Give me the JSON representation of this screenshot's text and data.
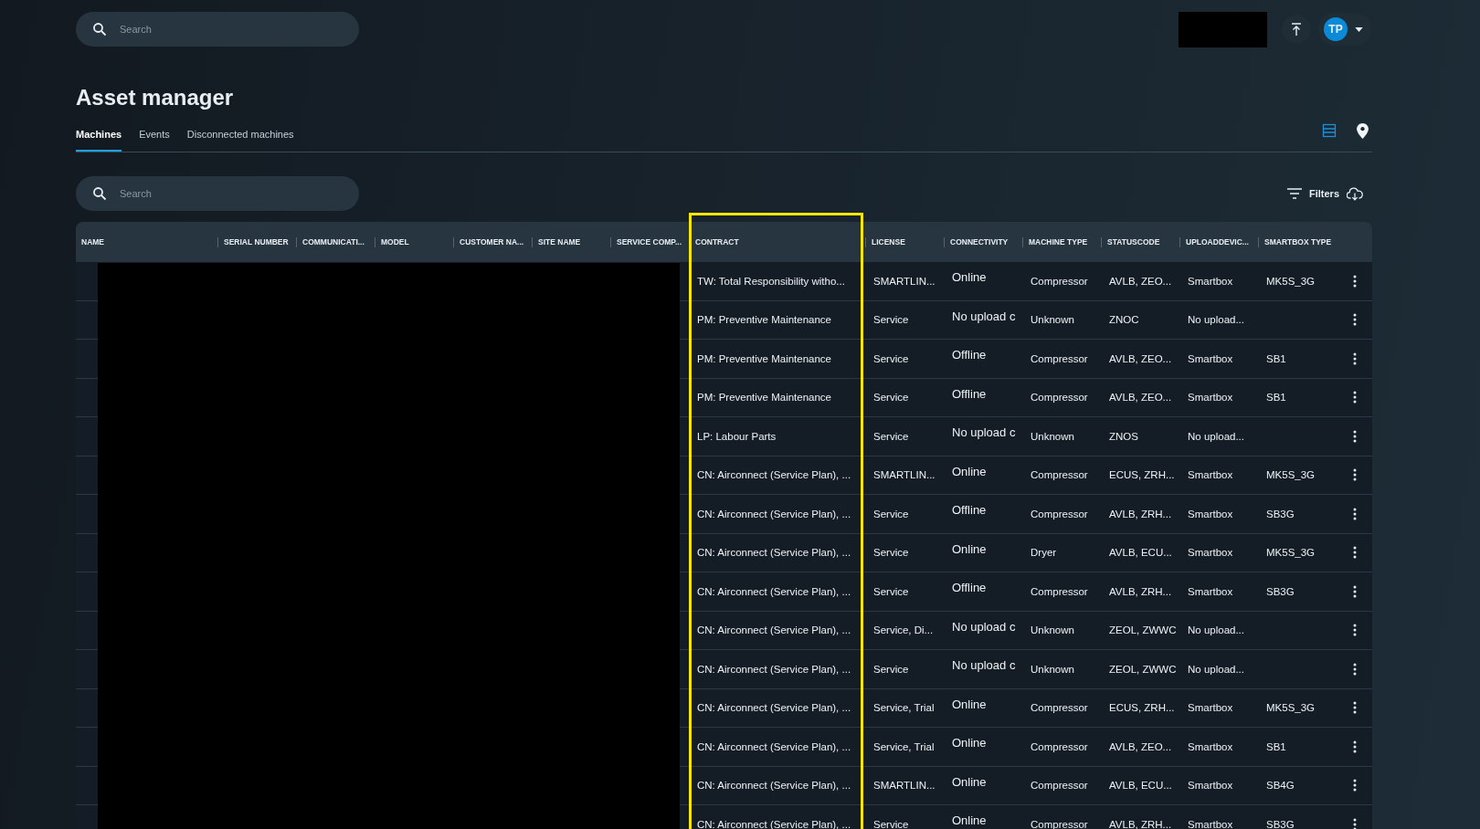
{
  "top_bar": {
    "search": {
      "placeholder": "Search"
    },
    "avatar": {
      "initials": "TP"
    }
  },
  "page": {
    "title": "Asset manager"
  },
  "tabs": [
    {
      "label": "Machines",
      "selected": true
    },
    {
      "label": "Events",
      "selected": false
    },
    {
      "label": "Disconnected machines",
      "selected": false
    }
  ],
  "views": [
    {
      "kind": "list",
      "selected": true
    },
    {
      "kind": "map",
      "selected": false
    }
  ],
  "search": {
    "placeholder": "Search"
  },
  "filters": {
    "label": "Filters"
  },
  "table": {
    "columns": [
      "NAME",
      "SERIAL NUMBER",
      "COMMUNICATI...",
      "MODEL",
      "CUSTOMER NA...",
      "SITE NAME",
      "SERVICE COMP...",
      "CONTRACT",
      "LICENSE",
      "CONNECTIVITY",
      "MACHINE TYPE",
      "STATUSCODE",
      "UPLOADDEVIC...",
      "SMARTBOX TYPE"
    ],
    "rows": [
      {
        "contract": "TW: Total Responsibility witho...",
        "license": "SMARTLIN...",
        "connectivity": "Online",
        "machine_type": "Compressor",
        "statuscode": "AVLB, ZEO...",
        "uploaddevice": "Smartbox",
        "smartbox_type": "MK5S_3G"
      },
      {
        "contract": "PM: Preventive Maintenance",
        "license": "Service",
        "connectivity": "No upload c",
        "machine_type": "Unknown",
        "statuscode": "ZNOC",
        "uploaddevice": "No upload...",
        "smartbox_type": ""
      },
      {
        "contract": "PM: Preventive Maintenance",
        "license": "Service",
        "connectivity": "Offline",
        "machine_type": "Compressor",
        "statuscode": "AVLB, ZEO...",
        "uploaddevice": "Smartbox",
        "smartbox_type": "SB1"
      },
      {
        "contract": "PM: Preventive Maintenance",
        "license": "Service",
        "connectivity": "Offline",
        "machine_type": "Compressor",
        "statuscode": "AVLB, ZEO...",
        "uploaddevice": "Smartbox",
        "smartbox_type": "SB1"
      },
      {
        "contract": "LP: Labour Parts",
        "license": "Service",
        "connectivity": "No upload c",
        "machine_type": "Unknown",
        "statuscode": "ZNOS",
        "uploaddevice": "No upload...",
        "smartbox_type": ""
      },
      {
        "contract": "CN: Airconnect (Service Plan), ...",
        "license": "SMARTLIN...",
        "connectivity": "Online",
        "machine_type": "Compressor",
        "statuscode": "ECUS, ZRH...",
        "uploaddevice": "Smartbox",
        "smartbox_type": "MK5S_3G"
      },
      {
        "contract": "CN: Airconnect (Service Plan), ...",
        "license": "Service",
        "connectivity": "Offline",
        "machine_type": "Compressor",
        "statuscode": "AVLB, ZRH...",
        "uploaddevice": "Smartbox",
        "smartbox_type": "SB3G"
      },
      {
        "contract": "CN: Airconnect (Service Plan), ...",
        "license": "Service",
        "connectivity": "Online",
        "machine_type": "Dryer",
        "statuscode": "AVLB, ECU...",
        "uploaddevice": "Smartbox",
        "smartbox_type": "MK5S_3G"
      },
      {
        "contract": "CN: Airconnect (Service Plan), ...",
        "license": "Service",
        "connectivity": "Offline",
        "machine_type": "Compressor",
        "statuscode": "AVLB, ZRH...",
        "uploaddevice": "Smartbox",
        "smartbox_type": "SB3G"
      },
      {
        "contract": "CN: Airconnect (Service Plan), ...",
        "license": "Service, Di...",
        "connectivity": "No upload c",
        "machine_type": "Unknown",
        "statuscode": "ZEOL, ZWWC",
        "uploaddevice": "No upload...",
        "smartbox_type": ""
      },
      {
        "contract": "CN: Airconnect (Service Plan), ...",
        "license": "Service",
        "connectivity": "No upload c",
        "machine_type": "Unknown",
        "statuscode": "ZEOL, ZWWC",
        "uploaddevice": "No upload...",
        "smartbox_type": ""
      },
      {
        "contract": "CN: Airconnect (Service Plan), ...",
        "license": "Service, Trial",
        "connectivity": "Online",
        "machine_type": "Compressor",
        "statuscode": "ECUS, ZRH...",
        "uploaddevice": "Smartbox",
        "smartbox_type": "MK5S_3G"
      },
      {
        "contract": "CN: Airconnect (Service Plan), ...",
        "license": "Service, Trial",
        "connectivity": "Online",
        "machine_type": "Compressor",
        "statuscode": "AVLB, ZEO...",
        "uploaddevice": "Smartbox",
        "smartbox_type": "SB1"
      },
      {
        "contract": "CN: Airconnect (Service Plan), ...",
        "license": "SMARTLIN...",
        "connectivity": "Online",
        "machine_type": "Compressor",
        "statuscode": "AVLB, ECU...",
        "uploaddevice": "Smartbox",
        "smartbox_type": "SB4G"
      },
      {
        "contract": "CN: Airconnect (Service Plan), ...",
        "license": "Service",
        "connectivity": "Online",
        "machine_type": "Compressor",
        "statuscode": "AVLB, ZRH...",
        "uploaddevice": "Smartbox",
        "smartbox_type": "SB3G"
      }
    ]
  }
}
